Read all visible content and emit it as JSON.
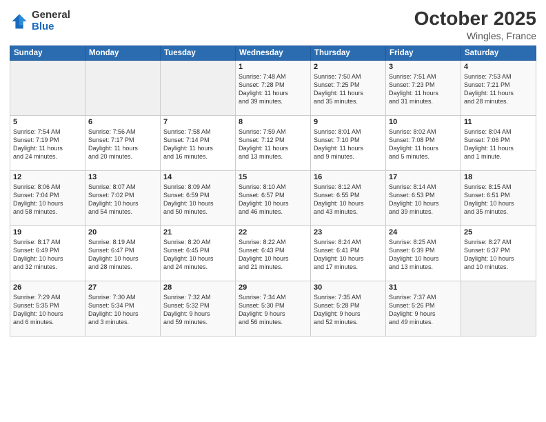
{
  "header": {
    "logo_general": "General",
    "logo_blue": "Blue",
    "month_title": "October 2025",
    "location": "Wingles, France"
  },
  "weekdays": [
    "Sunday",
    "Monday",
    "Tuesday",
    "Wednesday",
    "Thursday",
    "Friday",
    "Saturday"
  ],
  "weeks": [
    [
      {
        "day": "",
        "info": ""
      },
      {
        "day": "",
        "info": ""
      },
      {
        "day": "",
        "info": ""
      },
      {
        "day": "1",
        "info": "Sunrise: 7:48 AM\nSunset: 7:28 PM\nDaylight: 11 hours\nand 39 minutes."
      },
      {
        "day": "2",
        "info": "Sunrise: 7:50 AM\nSunset: 7:25 PM\nDaylight: 11 hours\nand 35 minutes."
      },
      {
        "day": "3",
        "info": "Sunrise: 7:51 AM\nSunset: 7:23 PM\nDaylight: 11 hours\nand 31 minutes."
      },
      {
        "day": "4",
        "info": "Sunrise: 7:53 AM\nSunset: 7:21 PM\nDaylight: 11 hours\nand 28 minutes."
      }
    ],
    [
      {
        "day": "5",
        "info": "Sunrise: 7:54 AM\nSunset: 7:19 PM\nDaylight: 11 hours\nand 24 minutes."
      },
      {
        "day": "6",
        "info": "Sunrise: 7:56 AM\nSunset: 7:17 PM\nDaylight: 11 hours\nand 20 minutes."
      },
      {
        "day": "7",
        "info": "Sunrise: 7:58 AM\nSunset: 7:14 PM\nDaylight: 11 hours\nand 16 minutes."
      },
      {
        "day": "8",
        "info": "Sunrise: 7:59 AM\nSunset: 7:12 PM\nDaylight: 11 hours\nand 13 minutes."
      },
      {
        "day": "9",
        "info": "Sunrise: 8:01 AM\nSunset: 7:10 PM\nDaylight: 11 hours\nand 9 minutes."
      },
      {
        "day": "10",
        "info": "Sunrise: 8:02 AM\nSunset: 7:08 PM\nDaylight: 11 hours\nand 5 minutes."
      },
      {
        "day": "11",
        "info": "Sunrise: 8:04 AM\nSunset: 7:06 PM\nDaylight: 11 hours\nand 1 minute."
      }
    ],
    [
      {
        "day": "12",
        "info": "Sunrise: 8:06 AM\nSunset: 7:04 PM\nDaylight: 10 hours\nand 58 minutes."
      },
      {
        "day": "13",
        "info": "Sunrise: 8:07 AM\nSunset: 7:02 PM\nDaylight: 10 hours\nand 54 minutes."
      },
      {
        "day": "14",
        "info": "Sunrise: 8:09 AM\nSunset: 6:59 PM\nDaylight: 10 hours\nand 50 minutes."
      },
      {
        "day": "15",
        "info": "Sunrise: 8:10 AM\nSunset: 6:57 PM\nDaylight: 10 hours\nand 46 minutes."
      },
      {
        "day": "16",
        "info": "Sunrise: 8:12 AM\nSunset: 6:55 PM\nDaylight: 10 hours\nand 43 minutes."
      },
      {
        "day": "17",
        "info": "Sunrise: 8:14 AM\nSunset: 6:53 PM\nDaylight: 10 hours\nand 39 minutes."
      },
      {
        "day": "18",
        "info": "Sunrise: 8:15 AM\nSunset: 6:51 PM\nDaylight: 10 hours\nand 35 minutes."
      }
    ],
    [
      {
        "day": "19",
        "info": "Sunrise: 8:17 AM\nSunset: 6:49 PM\nDaylight: 10 hours\nand 32 minutes."
      },
      {
        "day": "20",
        "info": "Sunrise: 8:19 AM\nSunset: 6:47 PM\nDaylight: 10 hours\nand 28 minutes."
      },
      {
        "day": "21",
        "info": "Sunrise: 8:20 AM\nSunset: 6:45 PM\nDaylight: 10 hours\nand 24 minutes."
      },
      {
        "day": "22",
        "info": "Sunrise: 8:22 AM\nSunset: 6:43 PM\nDaylight: 10 hours\nand 21 minutes."
      },
      {
        "day": "23",
        "info": "Sunrise: 8:24 AM\nSunset: 6:41 PM\nDaylight: 10 hours\nand 17 minutes."
      },
      {
        "day": "24",
        "info": "Sunrise: 8:25 AM\nSunset: 6:39 PM\nDaylight: 10 hours\nand 13 minutes."
      },
      {
        "day": "25",
        "info": "Sunrise: 8:27 AM\nSunset: 6:37 PM\nDaylight: 10 hours\nand 10 minutes."
      }
    ],
    [
      {
        "day": "26",
        "info": "Sunrise: 7:29 AM\nSunset: 5:35 PM\nDaylight: 10 hours\nand 6 minutes."
      },
      {
        "day": "27",
        "info": "Sunrise: 7:30 AM\nSunset: 5:34 PM\nDaylight: 10 hours\nand 3 minutes."
      },
      {
        "day": "28",
        "info": "Sunrise: 7:32 AM\nSunset: 5:32 PM\nDaylight: 9 hours\nand 59 minutes."
      },
      {
        "day": "29",
        "info": "Sunrise: 7:34 AM\nSunset: 5:30 PM\nDaylight: 9 hours\nand 56 minutes."
      },
      {
        "day": "30",
        "info": "Sunrise: 7:35 AM\nSunset: 5:28 PM\nDaylight: 9 hours\nand 52 minutes."
      },
      {
        "day": "31",
        "info": "Sunrise: 7:37 AM\nSunset: 5:26 PM\nDaylight: 9 hours\nand 49 minutes."
      },
      {
        "day": "",
        "info": ""
      }
    ]
  ]
}
